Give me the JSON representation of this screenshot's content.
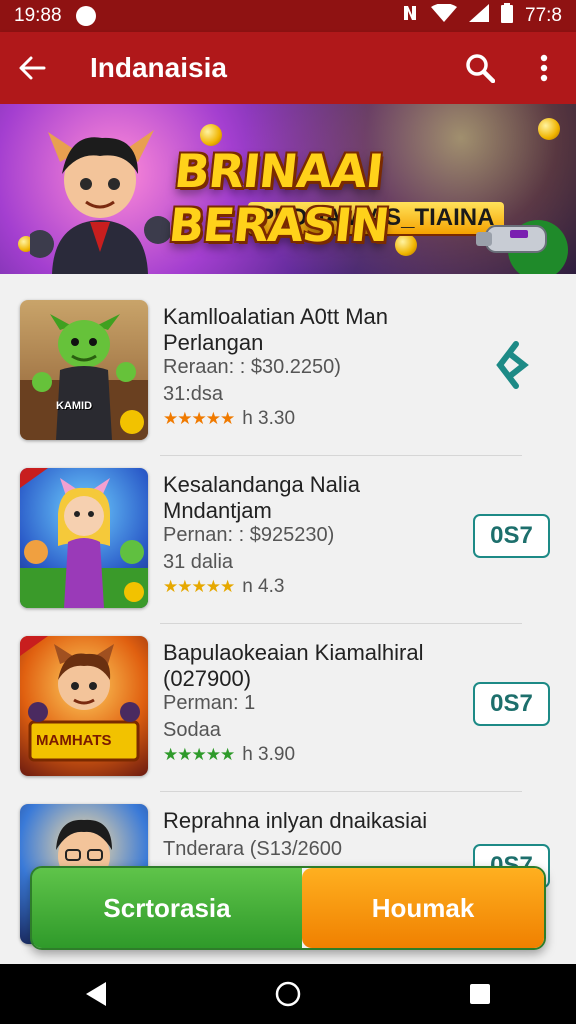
{
  "status_bar": {
    "time_left": "19:88",
    "time_right": "77:8"
  },
  "app_bar": {
    "title": "Indanaisia"
  },
  "banner": {
    "logo_main": "BRINAAI BERASIN",
    "logo_sub": "PEDNAM AS_TIAINA"
  },
  "games": [
    {
      "name": "Kamlloalatian A0tt Man Perlangan",
      "price": "Reraan: : $30.2250)",
      "size": "31:dsa",
      "rating": "h 3.30",
      "star_color": "#f07a00",
      "action": "loading",
      "thumb_text": "KAMID"
    },
    {
      "name": "Kesalandanga Nalia Mndantjam",
      "price": "Pernan: : $925230)",
      "size": "31 dalia",
      "rating": "n 4.3",
      "star_color": "#e6a800",
      "action_label": "0S7"
    },
    {
      "name": "Bapulaokeaian Kiamalhiral (027900)",
      "price": "Perman: 1",
      "size": "Sodaa",
      "rating": "h 3.90",
      "star_color": "#2e9a2a",
      "action_label": "0S7",
      "thumb_text": "MAMHATS"
    },
    {
      "name": "Reprahna inlyan dnaikasiai",
      "price": "Tnderara (S13/2600",
      "action_label": "0S7"
    }
  ],
  "bottom_bar": {
    "left_label": "Scrtorasia",
    "right_label": "Houmak"
  },
  "colors": {
    "status_bar": "#8f1212",
    "app_bar": "#b0181a",
    "accent_teal": "#1d8a86",
    "green": "#3aa534",
    "orange": "#f59000"
  }
}
